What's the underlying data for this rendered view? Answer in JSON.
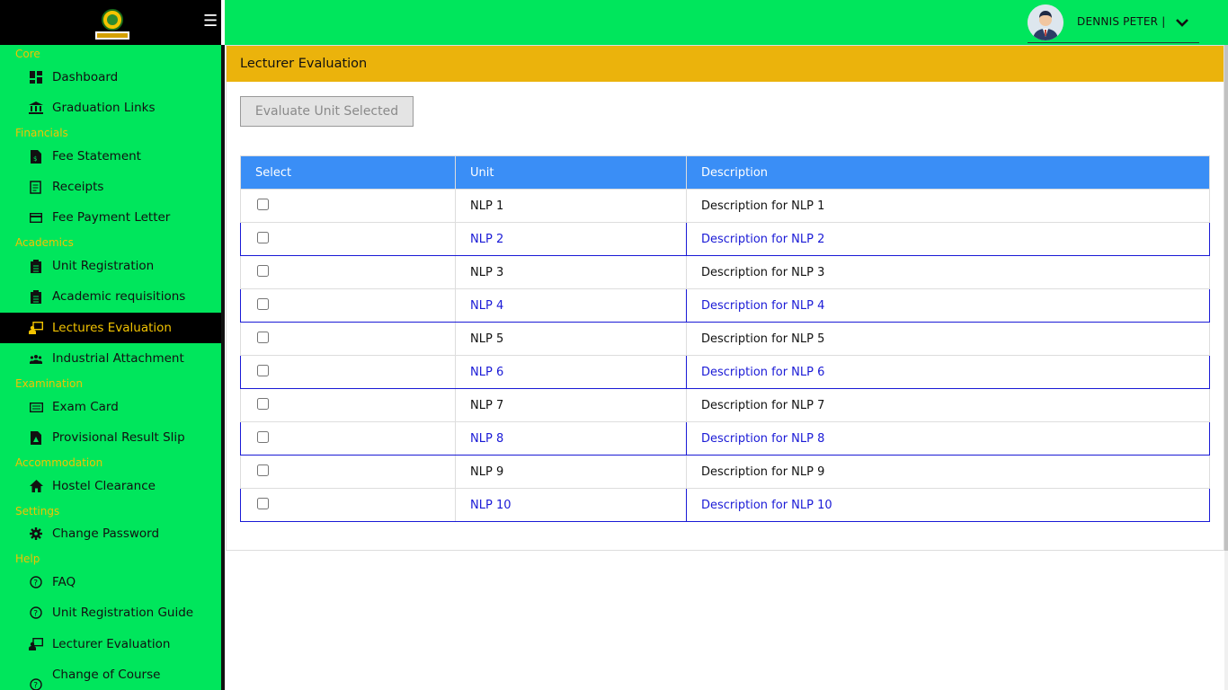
{
  "brand": {
    "logo_name": "university-logo",
    "menu_icon": "☰"
  },
  "sidebar": {
    "sections": [
      {
        "title": "Core"
      },
      {
        "title": "Financials"
      },
      {
        "title": "Academics"
      },
      {
        "title": "Examination"
      },
      {
        "title": "Accommodation"
      },
      {
        "title": "Settings"
      },
      {
        "title": "Help"
      }
    ],
    "items": [
      {
        "label": "Dashboard",
        "icon": "dashboard-icon"
      },
      {
        "label": "Graduation Links",
        "icon": "bank-icon"
      },
      {
        "label": "Fee Statement",
        "icon": "file-invoice-icon"
      },
      {
        "label": "Receipts",
        "icon": "receipt-icon"
      },
      {
        "label": "Fee Payment Letter",
        "icon": "credit-card-icon"
      },
      {
        "label": "Unit Registration",
        "icon": "clipboard-icon"
      },
      {
        "label": "Academic requisitions",
        "icon": "clipboard-icon"
      },
      {
        "label": "Lectures Evaluation",
        "icon": "teacher-icon",
        "active": true
      },
      {
        "label": "Industrial Attachment",
        "icon": "users-icon"
      },
      {
        "label": "Exam Card",
        "icon": "id-card-icon"
      },
      {
        "label": "Provisional Result Slip",
        "icon": "file-pdf-icon"
      },
      {
        "label": "Hostel Clearance",
        "icon": "home-icon"
      },
      {
        "label": "Change Password",
        "icon": "gear-icon"
      },
      {
        "label": "FAQ",
        "icon": "question-circle-icon"
      },
      {
        "label": "Unit Registration Guide",
        "icon": "question-circle-icon"
      },
      {
        "label": "Lecturer Evaluation",
        "icon": "teacher-icon"
      },
      {
        "label": "Change of Course",
        "icon": "question-circle-icon"
      }
    ]
  },
  "topbar": {
    "user_name": "DENNIS PETER |"
  },
  "main": {
    "title": "Lecturer Evaluation",
    "evaluate_button": "Evaluate Unit Selected",
    "table": {
      "headers": [
        "Select",
        "Unit",
        "Description"
      ],
      "rows": [
        {
          "unit": "NLP 1",
          "description": "Description for NLP 1"
        },
        {
          "unit": "NLP 2",
          "description": "Description for NLP 2"
        },
        {
          "unit": "NLP 3",
          "description": "Description for NLP 3"
        },
        {
          "unit": "NLP 4",
          "description": "Description for NLP 4"
        },
        {
          "unit": "NLP 5",
          "description": "Description for NLP 5"
        },
        {
          "unit": "NLP 6",
          "description": "Description for NLP 6"
        },
        {
          "unit": "NLP 7",
          "description": "Description for NLP 7"
        },
        {
          "unit": "NLP 8",
          "description": "Description for NLP 8"
        },
        {
          "unit": "NLP 9",
          "description": "Description for NLP 9"
        },
        {
          "unit": "NLP 10",
          "description": "Description for NLP 10"
        }
      ]
    }
  },
  "colors": {
    "sidebar_bg": "#00e65c",
    "section_text": "#f2c300",
    "header_yellow": "#ebb30c",
    "table_header": "#3a8ef6",
    "even_row_text": "#1a1ad6"
  }
}
